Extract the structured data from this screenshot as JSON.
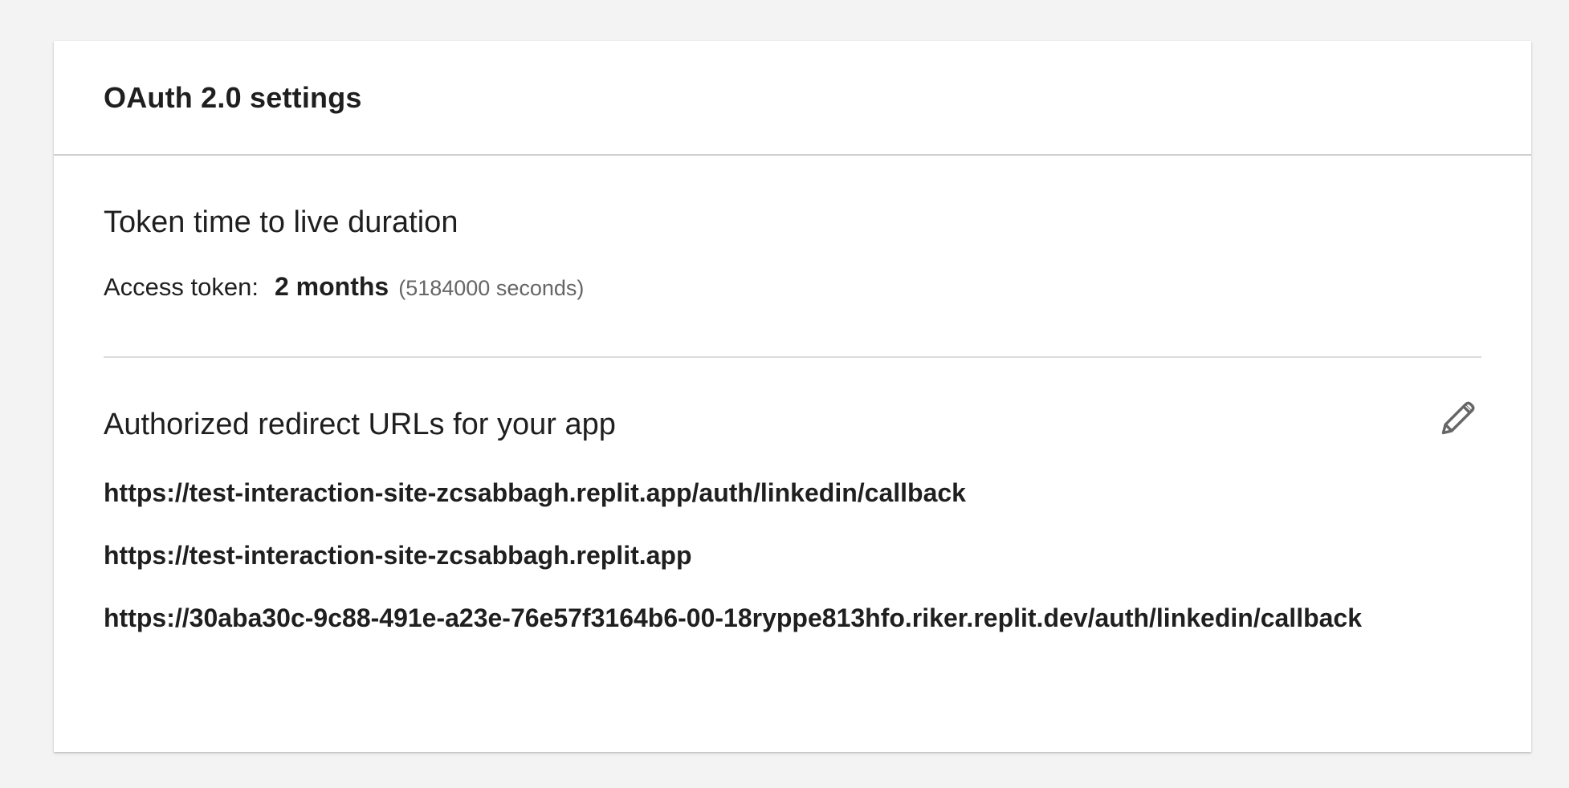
{
  "card": {
    "title": "OAuth 2.0 settings"
  },
  "token_section": {
    "title": "Token time to live duration",
    "access_token_label": "Access token:",
    "access_token_value": "2 months",
    "access_token_seconds": "(5184000 seconds)"
  },
  "redirect_section": {
    "title": "Authorized redirect URLs for your app",
    "edit_icon": "pencil-icon",
    "urls": [
      "https://test-interaction-site-zcsabbagh.replit.app/auth/linkedin/callback",
      "https://test-interaction-site-zcsabbagh.replit.app",
      "https://30aba30c-9c88-491e-a23e-76e57f3164b6-00-18ryppe813hfo.riker.replit.dev/auth/linkedin/callback"
    ]
  },
  "colors": {
    "background": "#f3f3f3",
    "card": "#ffffff",
    "text": "#1f1f1f",
    "muted_text": "#666666",
    "divider": "#cfcfcf",
    "icon": "#666666"
  }
}
